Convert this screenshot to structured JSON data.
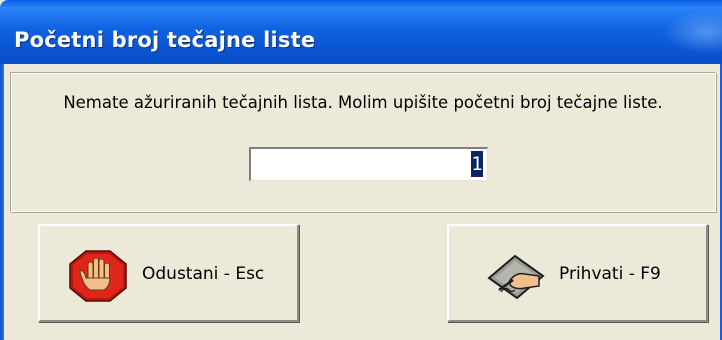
{
  "dialog": {
    "title": "Početni broj tečajne liste",
    "message": "Nemate ažuriranih tečajnih lista. Molim upišite početni broj tečajne liste.",
    "start_number_value": "1",
    "cancel_label": "Odustani - Esc",
    "cancel_icon": "stop-hand-icon",
    "accept_label": "Prihvati - F9",
    "accept_icon": "signing-hand-icon"
  },
  "colors": {
    "title_bar": "#0b55d3",
    "window_background": "#ece9d8",
    "selection": "#0a246a",
    "stop_sign": "#c81d14"
  }
}
